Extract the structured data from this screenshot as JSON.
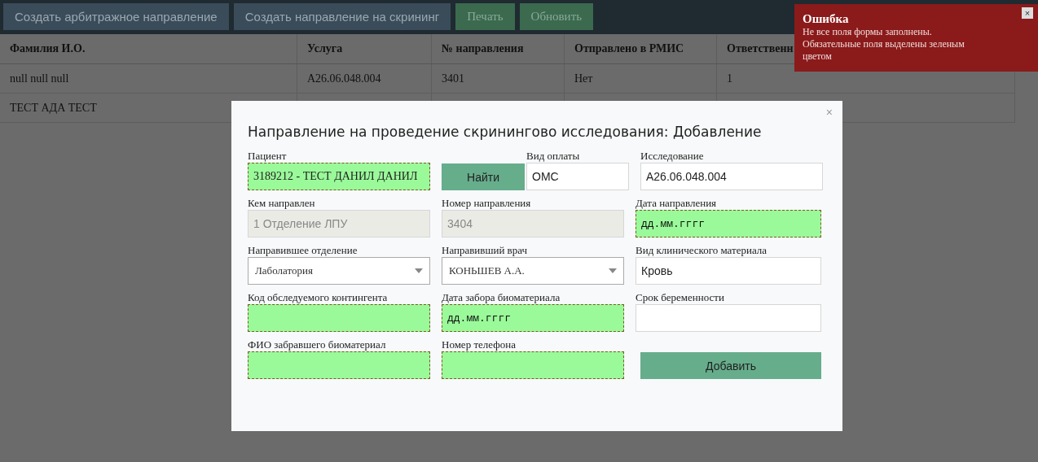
{
  "toolbar": {
    "buttons": [
      {
        "label": "Создать арбитражное направление",
        "kind": "primary"
      },
      {
        "label": "Создать направление на скрининг",
        "kind": "primary"
      },
      {
        "label": "Печать",
        "kind": "success"
      },
      {
        "label": "Обновить",
        "kind": "success"
      }
    ]
  },
  "table": {
    "columns": [
      "Фамилия И.О.",
      "Услуга",
      "№ направления",
      "Отправлено в РМИС",
      "Ответственн"
    ],
    "rows": [
      [
        "null null null",
        "A26.06.048.004",
        "3401",
        "Нет",
        "1"
      ],
      [
        "ТЕСТ АДА ТЕСТ"
      ]
    ]
  },
  "dialog": {
    "title": "Направление на проведение скринингово исследования: Добавление",
    "close": "×",
    "rows": [
      [
        {
          "kind": "input",
          "label": "Пациент",
          "value": "3189212 - ТЕСТ ДАНИЛ ДАНИЛ",
          "invalid": true,
          "disabled": false
        },
        {
          "kind": "button",
          "label": "Найти"
        },
        {
          "kind": "input",
          "label": "Вид оплаты",
          "value": "ОМС",
          "invalid": false,
          "disabled": false
        },
        {
          "kind": "input",
          "label": "Исследование",
          "value": "A26.06.048.004",
          "invalid": false,
          "disabled": false
        }
      ],
      [
        {
          "kind": "input",
          "label": "Кем направлен",
          "value": "1 Отделение ЛПУ",
          "invalid": false,
          "disabled": true
        },
        {
          "kind": "input",
          "label": "Номер направления",
          "value": "3404",
          "invalid": false,
          "disabled": true
        },
        {
          "kind": "input",
          "label": "Дата направления",
          "placeholder": "дд.мм.гггг",
          "invalid": true,
          "disabled": false
        }
      ],
      [
        {
          "kind": "select",
          "label": "Направившее отделение",
          "value": "Лаболатория"
        },
        {
          "kind": "select",
          "label": "Направивший врач",
          "value": "КОНЬШЕВ А.А."
        },
        {
          "kind": "input",
          "label": "Вид клинического материала",
          "value": "Кровь",
          "invalid": false,
          "disabled": false
        }
      ],
      [
        {
          "kind": "input",
          "label": "Код обследуемого контингента",
          "invalid": true,
          "disabled": false
        },
        {
          "kind": "input",
          "label": "Дата забора биоматериала",
          "placeholder": "дд.мм.гггг",
          "invalid": true,
          "disabled": false
        },
        {
          "kind": "input",
          "label": "Срок беременности",
          "invalid": false,
          "disabled": false
        }
      ],
      [
        {
          "kind": "input",
          "label": "ФИО забравшего биоматериал",
          "invalid": true,
          "disabled": false
        },
        {
          "kind": "input",
          "label": "Номер телефона",
          "invalid": true,
          "disabled": false
        },
        {
          "kind": "button",
          "label": "Добавить"
        }
      ]
    ]
  },
  "toast": {
    "title": "Ошибка",
    "message": "Не все поля формы заполнены. Обязательные поля выделены зеленым цветом",
    "close": "×"
  }
}
